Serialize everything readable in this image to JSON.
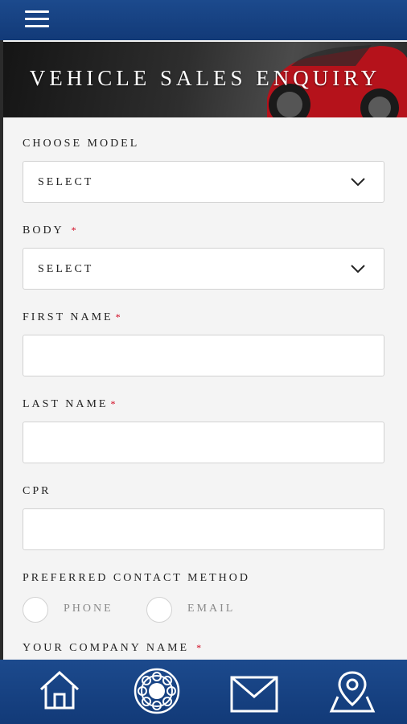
{
  "header": {
    "menu_icon": "hamburger-menu-icon"
  },
  "banner": {
    "title": "VEHICLE SALES ENQUIRY"
  },
  "form": {
    "choose_model": {
      "label": "CHOOSE MODEL",
      "value": "SELECT"
    },
    "body": {
      "label": "BODY",
      "required_mark": "*",
      "value": "SELECT"
    },
    "first_name": {
      "label": "FIRST NAME",
      "required_mark": "*",
      "value": ""
    },
    "last_name": {
      "label": "LAST NAME",
      "required_mark": "*",
      "value": ""
    },
    "cpr": {
      "label": "CPR",
      "value": ""
    },
    "preferred_contact": {
      "label": "PREFERRED CONTACT METHOD",
      "options": [
        "PHONE",
        "EMAIL"
      ]
    },
    "company_name": {
      "label": "YOUR COMPANY NAME",
      "required_mark": "*"
    }
  },
  "bottom_nav": {
    "items": [
      {
        "icon": "home-icon"
      },
      {
        "icon": "brand-emblem-icon"
      },
      {
        "icon": "mail-icon"
      },
      {
        "icon": "map-location-icon"
      }
    ]
  },
  "colors": {
    "bar_blue": "#1c4a8d",
    "required_red": "#d0021b",
    "banner_car_red": "#c4161c"
  }
}
